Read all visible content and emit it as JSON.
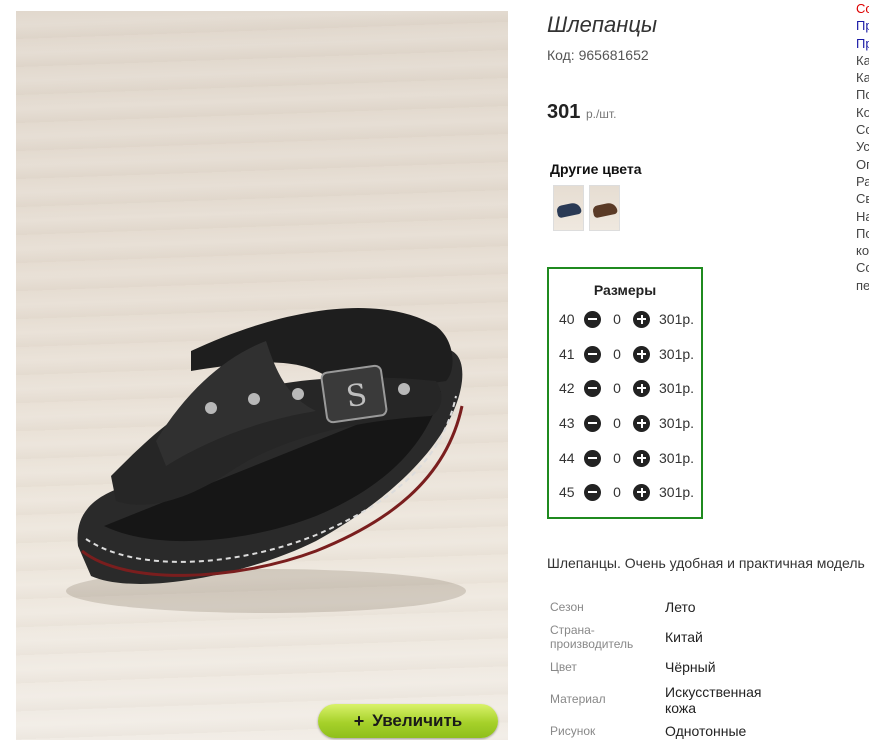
{
  "product": {
    "title": "Шлепанцы",
    "code": "Код: 965681652",
    "price": "301",
    "price_unit": "р./шт."
  },
  "zoom_button": {
    "label": "Увеличить"
  },
  "other_colors": {
    "title": "Другие цвета",
    "swatches": [
      {
        "name": "blue",
        "color": "#2a3a55"
      },
      {
        "name": "brown",
        "color": "#5a3a26"
      }
    ]
  },
  "sizes": {
    "title": "Размеры",
    "rows": [
      {
        "size": "40",
        "qty": "0",
        "price": "301р."
      },
      {
        "size": "41",
        "qty": "0",
        "price": "301р."
      },
      {
        "size": "42",
        "qty": "0",
        "price": "301р."
      },
      {
        "size": "43",
        "qty": "0",
        "price": "301р."
      },
      {
        "size": "44",
        "qty": "0",
        "price": "301р."
      },
      {
        "size": "45",
        "qty": "0",
        "price": "301р."
      }
    ]
  },
  "description": "Шлепанцы. Очень удобная и практичная модель",
  "attributes": [
    {
      "label": "Сезон",
      "value": "Лето"
    },
    {
      "label": "Страна-\nпроизводитель",
      "value": "Китай"
    },
    {
      "label": "Цвет",
      "value": "Чёрный"
    },
    {
      "label": "Материал",
      "value": "Искусственная\nкожа"
    },
    {
      "label": "Рисунок",
      "value": "Однотонные"
    }
  ],
  "right_column": {
    "lines": [
      "Со",
      "Пр",
      "Пр",
      "Ка",
      "Ка",
      "По",
      "Ко",
      "Со",
      "Ус",
      "Оп",
      "Ра",
      "Св",
      "На",
      "По",
      "ко",
      "Со",
      "пе"
    ]
  },
  "colors": {
    "accent_green": "#1f8a1f",
    "zoom_button_green": "#a6d12a",
    "link_blue": "#1a1aa6",
    "alert_red": "#d00000"
  }
}
